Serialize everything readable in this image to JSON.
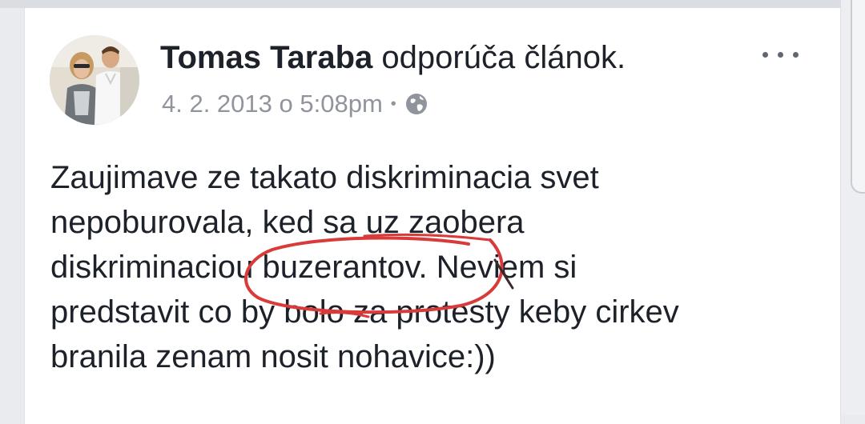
{
  "post": {
    "author": "Tomas Taraba",
    "action": "odporúča článok.",
    "timestamp": "4. 2. 2013 o 5:08pm",
    "separator": "•",
    "privacy_icon": "globe-icon",
    "more_icon": "more-options-icon",
    "text_lines": [
      "Zaujimave ze takato diskriminacia svet",
      "nepoburovala, ked sa uz zaobera",
      "diskriminaciou buzerantov. Neviem si",
      "predstavit co by bolo za protesty keby cirkev",
      "branila zenam nosit nohavice:))"
    ]
  },
  "annotation": {
    "color": "#d93a3a",
    "meaning": "red circled word"
  }
}
